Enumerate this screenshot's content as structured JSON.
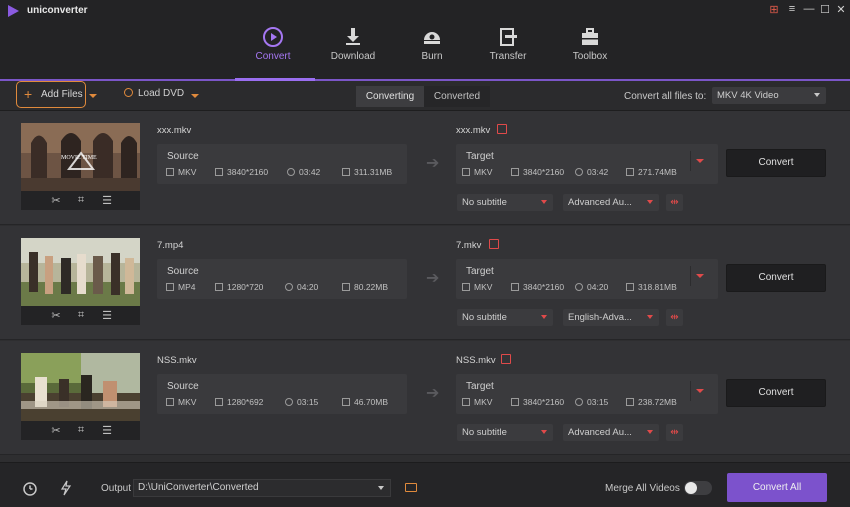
{
  "app": {
    "name": "uniconverter"
  },
  "nav": [
    {
      "label": "Convert",
      "icon": "convert-icon",
      "active": true
    },
    {
      "label": "Download",
      "icon": "download-icon",
      "active": false
    },
    {
      "label": "Burn",
      "icon": "burn-icon",
      "active": false
    },
    {
      "label": "Transfer",
      "icon": "transfer-icon",
      "active": false
    },
    {
      "label": "Toolbox",
      "icon": "toolbox-icon",
      "active": false
    }
  ],
  "toolbar": {
    "add_files": "Add Files",
    "load_dvd": "Load DVD",
    "tab_converting": "Converting",
    "tab_converted": "Converted",
    "convert_all_to_label": "Convert all files to:",
    "convert_all_to_value": "MKV 4K Video"
  },
  "files": [
    {
      "name": "xxx.mkv",
      "source": {
        "title": "Source",
        "format": "MKV",
        "resolution": "3840*2160",
        "duration": "03:42",
        "size": "311.31MB"
      },
      "target_name": "xxx.mkv",
      "target": {
        "title": "Target",
        "format": "MKV",
        "resolution": "3840*2160",
        "duration": "03:42",
        "size": "271.74MB"
      },
      "subtitle": "No subtitle",
      "audio": "Advanced Au...",
      "convert": "Convert"
    },
    {
      "name": "7.mp4",
      "source": {
        "title": "Source",
        "format": "MP4",
        "resolution": "1280*720",
        "duration": "04:20",
        "size": "80.22MB"
      },
      "target_name": "7.mkv",
      "target": {
        "title": "Target",
        "format": "MKV",
        "resolution": "3840*2160",
        "duration": "04:20",
        "size": "318.81MB"
      },
      "subtitle": "No subtitle",
      "audio": "English-Adva...",
      "convert": "Convert"
    },
    {
      "name": "NSS.mkv",
      "source": {
        "title": "Source",
        "format": "MKV",
        "resolution": "1280*692",
        "duration": "03:15",
        "size": "46.70MB"
      },
      "target_name": "NSS.mkv",
      "target": {
        "title": "Target",
        "format": "MKV",
        "resolution": "3840*2160",
        "duration": "03:15",
        "size": "238.72MB"
      },
      "subtitle": "No subtitle",
      "audio": "Advanced Au...",
      "convert": "Convert"
    }
  ],
  "bottom": {
    "output_label": "Output",
    "output_path": "D:\\UniConverter\\Converted",
    "merge_label": "Merge All Videos",
    "merge_on": false,
    "convert_all": "Convert All"
  },
  "colors": {
    "accent": "#7c52cc",
    "orange": "#e08a3c",
    "red": "#e04a4a"
  }
}
